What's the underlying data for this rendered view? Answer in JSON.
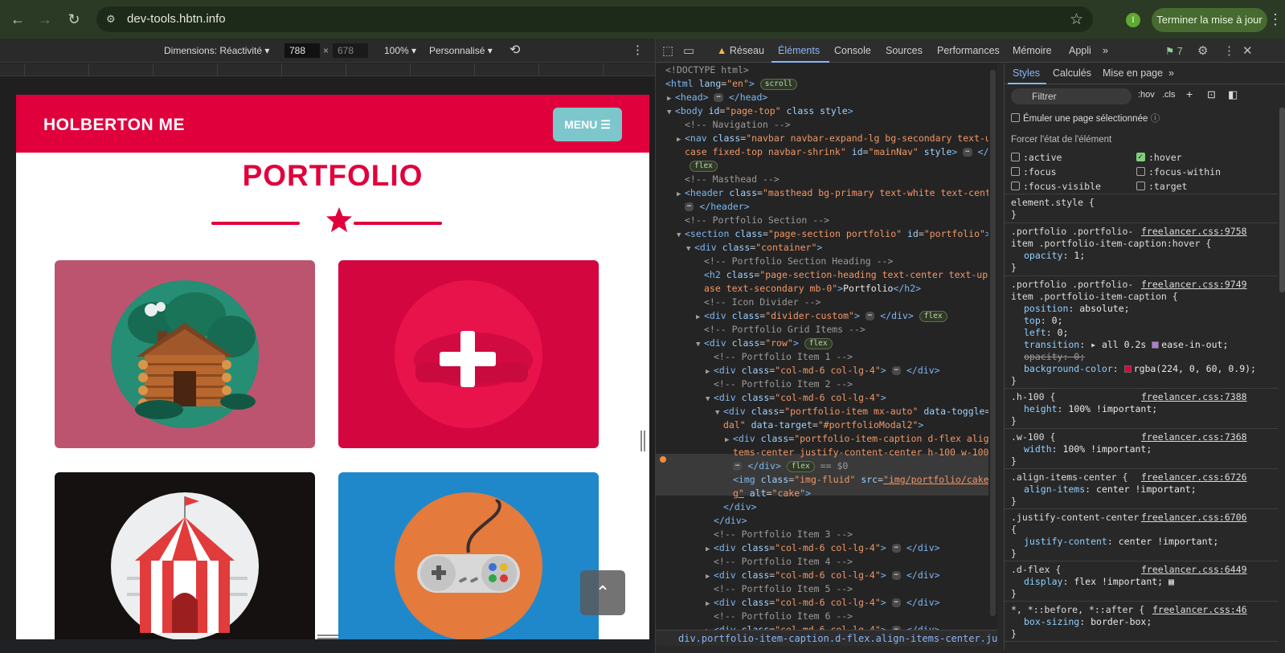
{
  "browser": {
    "url": "dev-tools.hbtn.info",
    "profile_initial": "I",
    "update_label": "Terminer la mise à jour"
  },
  "device_toolbar": {
    "dimensions_label": "Dimensions: Réactivité",
    "width": "788",
    "height": "678",
    "zoom": "100%",
    "throttle": "Personnalisé"
  },
  "site": {
    "brand": "HOLBERTON ME",
    "menu_label": "MENU",
    "section_title": "PORTFOLIO",
    "colors": {
      "primary": "#e0003c",
      "menu": "#7dc6cc"
    }
  },
  "devtools": {
    "tabs": [
      "Réseau",
      "Éléments",
      "Console",
      "Sources",
      "Performances",
      "Mémoire",
      "Appli"
    ],
    "active_tab": "Éléments",
    "issues_count": "7",
    "breadcrumb": "div.portfolio-item-caption.d-flex.align-items-center.justify-content-center.",
    "styles_tabs": [
      "Styles",
      "Calculés",
      "Mise en page"
    ],
    "filter_placeholder": "Filtrer",
    "hov": ":hov",
    "cls": ".cls",
    "emulate_label": "Émuler une page sélectionnée",
    "force_state_label": "Forcer l'état de l'élément",
    "states": [
      {
        "name": ":active",
        "checked": false
      },
      {
        "name": ":hover",
        "checked": true
      },
      {
        "name": ":focus",
        "checked": false
      },
      {
        "name": ":focus-within",
        "checked": false
      },
      {
        "name": ":focus-visible",
        "checked": false
      },
      {
        "name": ":target",
        "checked": false
      }
    ]
  }
}
